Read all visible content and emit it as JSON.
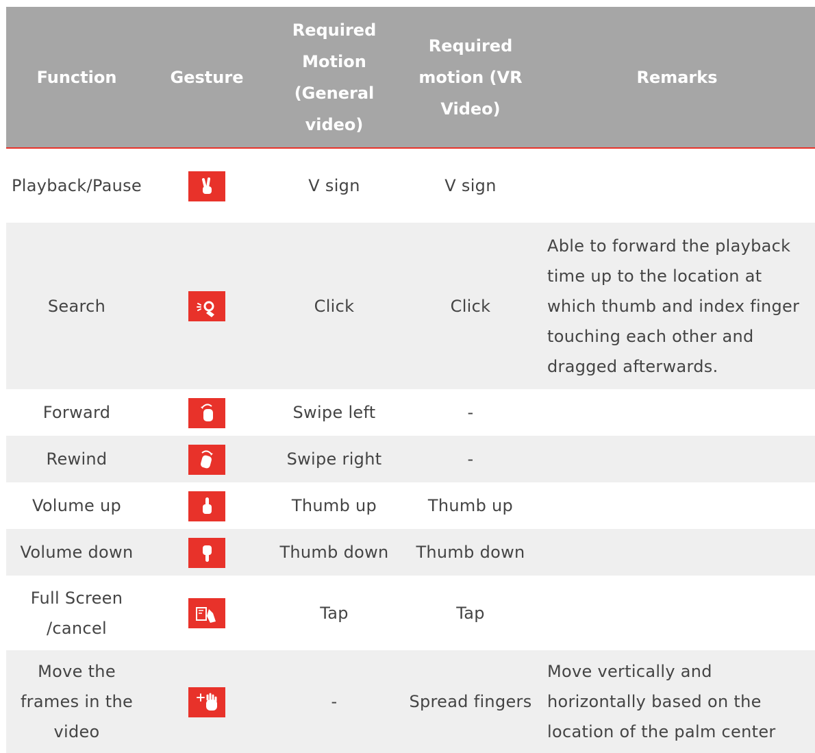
{
  "header": {
    "function": "Function",
    "gesture": "Gesture",
    "motion_general": "Required Motion (General video)",
    "motion_vr": "Required motion (VR Video)",
    "remarks": "Remarks"
  },
  "rows": [
    {
      "function": "Playback/Pause",
      "gesture_icon": "v-sign-icon",
      "general": "V sign",
      "vr": "V sign",
      "remarks": ""
    },
    {
      "function": "Search",
      "gesture_icon": "click-icon",
      "general": "Click",
      "vr": "Click",
      "remarks": "Able to forward the playback time up to the location at which thumb and index finger touching each other and dragged afterwards."
    },
    {
      "function": "Forward",
      "gesture_icon": "swipe-left-icon",
      "general": "Swipe left",
      "vr": "-",
      "remarks": ""
    },
    {
      "function": "Rewind",
      "gesture_icon": "swipe-right-icon",
      "general": "Swipe right",
      "vr": "-",
      "remarks": ""
    },
    {
      "function": "Volume up",
      "gesture_icon": "thumb-up-icon",
      "general": "Thumb up",
      "vr": "Thumb up",
      "remarks": ""
    },
    {
      "function": "Volume down",
      "gesture_icon": "thumb-down-icon",
      "general": "Thumb down",
      "vr": "Thumb down",
      "remarks": ""
    },
    {
      "function": "Full Screen /cancel",
      "gesture_icon": "tap-icon",
      "general": "Tap",
      "vr": "Tap",
      "remarks": ""
    },
    {
      "function": "Move the frames in the video",
      "gesture_icon": "spread-fingers-icon",
      "general": "-",
      "vr": "Spread fingers",
      "remarks": "Move vertically and horizontally based on the location of the palm center"
    }
  ],
  "colors": {
    "header_bg": "#a6a6a6",
    "accent_red": "#e8322a",
    "stripe": "#efefef",
    "text": "#444444"
  }
}
